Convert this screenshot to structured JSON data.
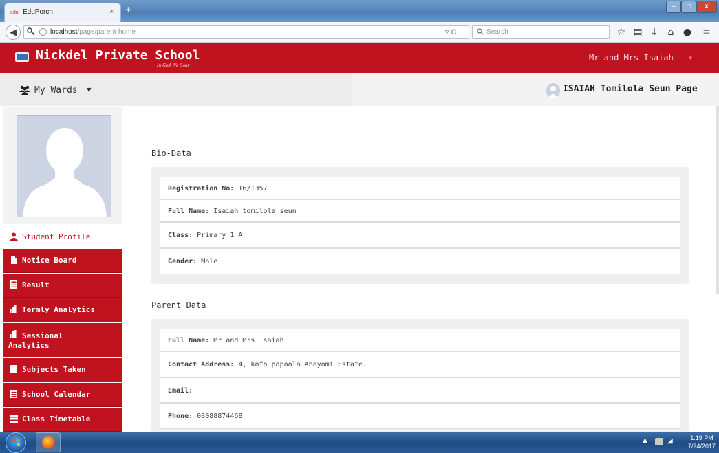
{
  "browser": {
    "tab_title": "EduPorch",
    "tab_favicon": "edu",
    "tab_close": "×",
    "tab_new": "+",
    "url_host": "localhost",
    "url_path": "/page/parent-home",
    "url_reload": "▿ C",
    "search_placeholder": "Search",
    "window_controls": {
      "minimize": "–",
      "maximize": "□",
      "close": "x"
    }
  },
  "header": {
    "school_name": "Nickdel Private School",
    "motto": "In God We Soar",
    "user_name": "Mr and Mrs Isaiah",
    "user_caret": "▾",
    "color": "#c1121f"
  },
  "subheader": {
    "wards_label": "My Wards",
    "wards_caret": "▼",
    "student_page_title": "ISAIAH Tomilola Seun Page"
  },
  "sidebar": {
    "items": [
      {
        "label": "Student Profile",
        "icon": "user-icon",
        "active": true
      },
      {
        "label": "Notice Board",
        "icon": "file-icon",
        "active": false
      },
      {
        "label": "Result",
        "icon": "calculator-icon",
        "active": false
      },
      {
        "label": "Termly Analytics",
        "icon": "bar-chart-icon",
        "active": false
      },
      {
        "label": "Sessional Analytics",
        "icon": "bar-chart-icon",
        "active": false
      },
      {
        "label": "Subjects Taken",
        "icon": "book-icon",
        "active": false
      },
      {
        "label": "School Calendar",
        "icon": "calendar-icon",
        "active": false
      },
      {
        "label": "Class Timetable",
        "icon": "list-icon",
        "active": false
      }
    ]
  },
  "bio": {
    "title": "Bio-Data",
    "fields": [
      {
        "label": "Registration No:",
        "value": "16/1357"
      },
      {
        "label": "Full Name:",
        "value": "Isaiah tomilola seun"
      },
      {
        "label": "Class:",
        "value": "Primary 1 A"
      },
      {
        "label": "Gender:",
        "value": "Male"
      }
    ]
  },
  "parent": {
    "title": "Parent Data",
    "fields": [
      {
        "label": "Full Name:",
        "value": "Mr and Mrs Isaiah"
      },
      {
        "label": "Contact Address:",
        "value": "4, kofo popoola Abayomi Estate."
      },
      {
        "label": "Email:",
        "value": ""
      },
      {
        "label": "Phone:",
        "value": "08088874468"
      }
    ]
  },
  "taskbar": {
    "time": "1:19 PM",
    "date": "7/24/2017"
  }
}
